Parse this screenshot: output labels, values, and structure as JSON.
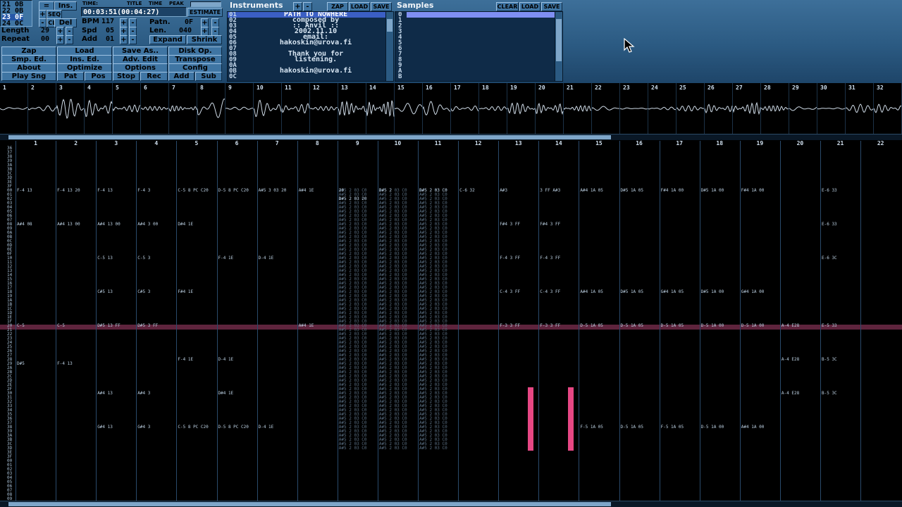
{
  "positions": [
    "21 0B",
    "22 0B",
    "23 0F",
    "24 0C"
  ],
  "current_position_index": 2,
  "top_buttons": {
    "eq": "=",
    "ins": "Ins.",
    "plus": "+",
    "minus": "-",
    "seq": "SEQ",
    "del": "Del",
    "clr": "CLR"
  },
  "time": {
    "label": "TIME:",
    "title_label": "TITLE",
    "time_label": "TIME",
    "peak_label": "PEAK",
    "value": "00:03:51(00:04:27)",
    "estimate": "ESTIMATE"
  },
  "song": {
    "length_label": "Length",
    "length_value": "29",
    "repeat_label": "Repeat",
    "repeat_value": "00",
    "bpm_label": "BPM",
    "bpm_value": "117",
    "spd_label": "Spd",
    "spd_value": "05",
    "add_label": "Add",
    "add_value": "01"
  },
  "pattern": {
    "patn_label": "Patn.",
    "patn_value": "0F",
    "len_label": "Len.",
    "len_value": "040",
    "expand": "Expand",
    "shrink": "Shrink"
  },
  "menu": [
    [
      "Zap",
      "Load",
      "Save As..",
      "Disk Op."
    ],
    [
      "Smp. Ed.",
      "Ins. Ed.",
      "Adv. Edit",
      "Transpose"
    ],
    [
      "About",
      "Optimize",
      "Options",
      "Config"
    ],
    [
      "Play Sng",
      "Pat",
      "Pos",
      "Stop",
      "Rec",
      "Add",
      "Sub"
    ]
  ],
  "instruments": {
    "title": "Instruments",
    "plus": "+",
    "minus": "-",
    "zap": "ZAP",
    "load": "LOAD",
    "save": "SAVE",
    "numbers": [
      "01",
      "02",
      "03",
      "04",
      "05",
      "06",
      "07",
      "08",
      "09",
      "0A",
      "0B",
      "0C"
    ],
    "lines": [
      "PATH TO NOWHERE",
      "composed by",
      ":: Anvil ::",
      "2002.11.10",
      "email:",
      "hakoskin@urova.fi",
      "",
      "Thank you for",
      "listening.",
      "",
      "hakoskin@urova.fi",
      ""
    ]
  },
  "samples": {
    "title": "Samples",
    "clear": "CLEAR",
    "load": "LOAD",
    "save": "SAVE",
    "numbers": [
      "0",
      "1",
      "2",
      "3",
      "4",
      "5",
      "6",
      "7",
      "8",
      "9",
      "A",
      "B"
    ]
  },
  "scopes": [
    "1",
    "2",
    "3",
    "4",
    "5",
    "6",
    "7",
    "8",
    "9",
    "10",
    "11",
    "12",
    "13",
    "14",
    "15",
    "16",
    "17",
    "18",
    "19",
    "20",
    "21",
    "22",
    "23",
    "24",
    "25",
    "26",
    "27",
    "28",
    "29",
    "30",
    "31",
    "32"
  ],
  "channels": [
    "1",
    "2",
    "3",
    "4",
    "5",
    "6",
    "7",
    "8",
    "9",
    "10",
    "11",
    "12",
    "13",
    "14",
    "15",
    "16",
    "17",
    "18",
    "19",
    "20",
    "21",
    "22"
  ],
  "row_numbers": [
    "36",
    "37",
    "38",
    "39",
    "3A",
    "3B",
    "3C",
    "3D",
    "3E",
    "3F",
    "00",
    "01",
    "02",
    "03",
    "04",
    "05",
    "06",
    "07",
    "08",
    "09",
    "0A",
    "0B",
    "0C",
    "0D",
    "0E",
    "0F",
    "10",
    "11",
    "12",
    "13",
    "14",
    "15",
    "16",
    "17",
    "18",
    "19",
    "1A",
    "1B",
    "1C",
    "1D",
    "1E",
    "1F",
    "20",
    "21",
    "22",
    "23",
    "24",
    "25",
    "26",
    "27",
    "28",
    "29",
    "2A",
    "2B",
    "2C",
    "2D",
    "2E",
    "2F",
    "30",
    "31",
    "32",
    "33",
    "34",
    "35",
    "36",
    "37",
    "38",
    "39",
    "3A",
    "3B",
    "3C",
    "3D",
    "3E",
    "3F",
    "00",
    "01",
    "02",
    "03",
    "04",
    "05",
    "06",
    "07",
    "08",
    "09",
    "0A",
    "0B",
    "0C"
  ],
  "pattern_cells": [
    {
      "ch": 0,
      "row": 10,
      "text": "F-4 13"
    },
    {
      "ch": 0,
      "row": 18,
      "text": "A#4 08"
    },
    {
      "ch": 0,
      "row": 42,
      "text": "C-5"
    },
    {
      "ch": 0,
      "row": 51,
      "text": "D#5"
    },
    {
      "ch": 1,
      "row": 10,
      "text": "F-4 13 20"
    },
    {
      "ch": 1,
      "row": 18,
      "text": "A#4 13 00"
    },
    {
      "ch": 1,
      "row": 42,
      "text": "C-5"
    },
    {
      "ch": 1,
      "row": 51,
      "text": "F-4 13"
    },
    {
      "ch": 2,
      "row": 10,
      "text": "F-4 13"
    },
    {
      "ch": 2,
      "row": 18,
      "text": "A#4 13 00"
    },
    {
      "ch": 2,
      "row": 26,
      "text": "C-5 13"
    },
    {
      "ch": 2,
      "row": 34,
      "text": "C#5 13"
    },
    {
      "ch": 2,
      "row": 42,
      "text": "D#5 13 FF"
    },
    {
      "ch": 2,
      "row": 58,
      "text": "A#4 13"
    },
    {
      "ch": 2,
      "row": 66,
      "text": "G#4 13"
    },
    {
      "ch": 3,
      "row": 10,
      "text": "F-4 3"
    },
    {
      "ch": 3,
      "row": 18,
      "text": "A#4 3 00"
    },
    {
      "ch": 3,
      "row": 26,
      "text": "C-5 3"
    },
    {
      "ch": 3,
      "row": 34,
      "text": "C#5 3"
    },
    {
      "ch": 3,
      "row": 42,
      "text": "D#5 3 FF"
    },
    {
      "ch": 3,
      "row": 58,
      "text": "A#4 3"
    },
    {
      "ch": 3,
      "row": 66,
      "text": "G#4 3"
    },
    {
      "ch": 4,
      "row": 10,
      "text": "C-5 8 PC C20"
    },
    {
      "ch": 4,
      "row": 18,
      "text": "D#4 1E"
    },
    {
      "ch": 4,
      "row": 34,
      "text": "F#4 1E"
    },
    {
      "ch": 4,
      "row": 50,
      "text": "F-4 1E"
    },
    {
      "ch": 4,
      "row": 66,
      "text": "C-5 8 PC C20"
    },
    {
      "ch": 5,
      "row": 10,
      "text": "D-5 8 PC C20"
    },
    {
      "ch": 5,
      "row": 26,
      "text": "F-4 1E"
    },
    {
      "ch": 5,
      "row": 50,
      "text": "D-4 1E"
    },
    {
      "ch": 5,
      "row": 58,
      "text": "D#4 1E"
    },
    {
      "ch": 5,
      "row": 66,
      "text": "D-5 8 PC C20"
    },
    {
      "ch": 6,
      "row": 10,
      "text": "A#5 3 03 20"
    },
    {
      "ch": 6,
      "row": 26,
      "text": "D-4 1E"
    },
    {
      "ch": 6,
      "row": 66,
      "text": "D-4 1E"
    },
    {
      "ch": 7,
      "row": 10,
      "text": "A#4 1E"
    },
    {
      "ch": 7,
      "row": 42,
      "text": "A#4 1E"
    },
    {
      "ch": 8,
      "row": 10,
      "text": "20"
    },
    {
      "ch": 8,
      "row": 12,
      "text": "D#5 2 03 20"
    },
    {
      "ch": 9,
      "row": 10,
      "text": "D#5 2"
    },
    {
      "ch": 10,
      "row": 10,
      "text": "D#5 2 03 C0"
    },
    {
      "ch": 11,
      "row": 10,
      "text": "C-6 32"
    },
    {
      "ch": 12,
      "row": 10,
      "text": "A#3"
    },
    {
      "ch": 12,
      "row": 18,
      "text": "F#4 3 FF"
    },
    {
      "ch": 12,
      "row": 26,
      "text": "F-4 3 FF"
    },
    {
      "ch": 12,
      "row": 34,
      "text": "C-4 3 FF"
    },
    {
      "ch": 12,
      "row": 42,
      "text": "F-3 3 FF"
    },
    {
      "ch": 13,
      "row": 10,
      "text": "3 FF A#3"
    },
    {
      "ch": 13,
      "row": 18,
      "text": "F#4 3 FF"
    },
    {
      "ch": 13,
      "row": 26,
      "text": "F-4 3 FF"
    },
    {
      "ch": 13,
      "row": 34,
      "text": "C-4 3 FF"
    },
    {
      "ch": 13,
      "row": 42,
      "text": "F-3 3 FF"
    },
    {
      "ch": 14,
      "row": 10,
      "text": "A#4 1A 05"
    },
    {
      "ch": 14,
      "row": 34,
      "text": "A#4 1A 05"
    },
    {
      "ch": 14,
      "row": 42,
      "text": "D-5 1A 05"
    },
    {
      "ch": 14,
      "row": 66,
      "text": "F-5 1A 05"
    },
    {
      "ch": 15,
      "row": 10,
      "text": "D#5 1A 05"
    },
    {
      "ch": 15,
      "row": 34,
      "text": "D#5 1A 05"
    },
    {
      "ch": 15,
      "row": 42,
      "text": "D-5 1A 05"
    },
    {
      "ch": 15,
      "row": 66,
      "text": "D-5 1A 05"
    },
    {
      "ch": 16,
      "row": 10,
      "text": "F#4 1A 00"
    },
    {
      "ch": 16,
      "row": 34,
      "text": "G#4 1A 05"
    },
    {
      "ch": 16,
      "row": 42,
      "text": "D-5 1A 05"
    },
    {
      "ch": 16,
      "row": 66,
      "text": "F-5 1A 05"
    },
    {
      "ch": 17,
      "row": 10,
      "text": "D#5 1A 00"
    },
    {
      "ch": 17,
      "row": 34,
      "text": "D#5 1A 00"
    },
    {
      "ch": 17,
      "row": 42,
      "text": "D-5 1A 00"
    },
    {
      "ch": 17,
      "row": 66,
      "text": "D-5 1A 00"
    },
    {
      "ch": 18,
      "row": 10,
      "text": "F#4 1A 00"
    },
    {
      "ch": 18,
      "row": 34,
      "text": "G#4 1A 00"
    },
    {
      "ch": 18,
      "row": 42,
      "text": "D-5 1A 00"
    },
    {
      "ch": 18,
      "row": 66,
      "text": "A#4 1A 00"
    },
    {
      "ch": 19,
      "row": 42,
      "text": "A-4 E28"
    },
    {
      "ch": 19,
      "row": 50,
      "text": "A-4 E28"
    },
    {
      "ch": 19,
      "row": 58,
      "text": "A-4 E28"
    },
    {
      "ch": 20,
      "row": 10,
      "text": "E-6 33"
    },
    {
      "ch": 20,
      "row": 18,
      "text": "E-6 33"
    },
    {
      "ch": 20,
      "row": 26,
      "text": "E-6 3C"
    },
    {
      "ch": 20,
      "row": 42,
      "text": "E-5 33"
    },
    {
      "ch": 20,
      "row": 50,
      "text": "B-5 3C"
    },
    {
      "ch": 20,
      "row": 58,
      "text": "B-5 3C"
    }
  ]
}
